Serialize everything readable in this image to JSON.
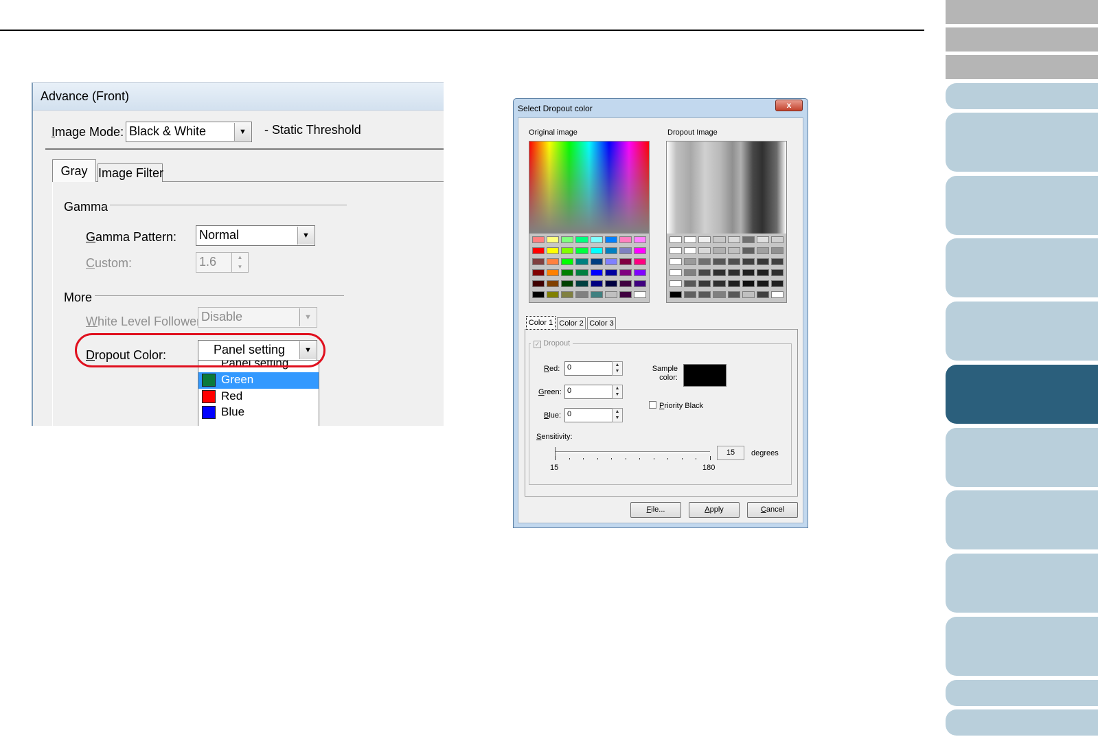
{
  "advance_dialog": {
    "title": "Advance (Front)",
    "image_mode_label": "Image Mode:",
    "image_mode_value": "Black & White",
    "static_threshold": "- Static Threshold",
    "tabs": [
      "Gray",
      "Image Filter"
    ],
    "gamma_group": "Gamma",
    "gamma_pattern_label": "Gamma Pattern:",
    "gamma_pattern_value": "Normal",
    "custom_label": "Custom:",
    "custom_value": "1.6",
    "more_group": "More",
    "white_level_label": "White Level Follower:",
    "white_level_value": "Disable",
    "dropout_label": "Dropout Color:",
    "dropout_value": "Panel setting",
    "dropdown_options": [
      {
        "label": "Panel setting",
        "color": ""
      },
      {
        "label": "Green",
        "color": "#0a7a3c",
        "selected": true
      },
      {
        "label": "Red",
        "color": "#ff0000"
      },
      {
        "label": "Blue",
        "color": "#0000ff"
      }
    ]
  },
  "select_dropout": {
    "title": "Select Dropout color",
    "close": "x",
    "original_label": "Original image",
    "dropout_image_label": "Dropout Image",
    "original_palette": [
      "#ff8080",
      "#ffff80",
      "#80ff80",
      "#00ff80",
      "#80ffff",
      "#0080ff",
      "#ff80c0",
      "#ff80ff",
      "#ff0000",
      "#ffff00",
      "#80ff00",
      "#00ff40",
      "#00ffff",
      "#0080c0",
      "#8080c0",
      "#ff00ff",
      "#804040",
      "#ff8040",
      "#00ff00",
      "#008080",
      "#004080",
      "#8080ff",
      "#800040",
      "#ff0080",
      "#800000",
      "#ff8000",
      "#008000",
      "#008040",
      "#0000ff",
      "#0000a0",
      "#800080",
      "#8000ff",
      "#400000",
      "#804000",
      "#004000",
      "#004040",
      "#000080",
      "#000040",
      "#400040",
      "#400080",
      "#000000",
      "#808000",
      "#808040",
      "#808080",
      "#408080",
      "#c0c0c0",
      "#400040",
      "#ffffff"
    ],
    "dropout_palette": [
      "#ffffff",
      "#ffffff",
      "#f0f0f0",
      "#c8c8c8",
      "#d8d8d8",
      "#707070",
      "#e0e0e0",
      "#d0d0d0",
      "#ffffff",
      "#ffffff",
      "#d8d8d8",
      "#b0b0b0",
      "#c0c0c0",
      "#606060",
      "#a0a0a0",
      "#909090",
      "#ffffff",
      "#9a9a9a",
      "#707070",
      "#585858",
      "#505050",
      "#404040",
      "#383838",
      "#404040",
      "#ffffff",
      "#808080",
      "#484848",
      "#303030",
      "#303030",
      "#202020",
      "#202020",
      "#303030",
      "#ffffff",
      "#585858",
      "#383838",
      "#303030",
      "#202020",
      "#101010",
      "#181818",
      "#202020",
      "#000000",
      "#606060",
      "#585858",
      "#808080",
      "#585858",
      "#c0c0c0",
      "#404040",
      "#ffffff"
    ],
    "tabs": [
      "Color 1",
      "Color 2",
      "Color 3"
    ],
    "dropout_check": "Dropout",
    "red_label": "Red:",
    "red_value": "0",
    "green_label": "Green:",
    "green_value": "0",
    "blue_label": "Blue:",
    "blue_value": "0",
    "sample_label": "Sample color:",
    "sample_color": "#000000",
    "priority_black": "Priority Black",
    "sensitivity_label": "Sensitivity:",
    "sensitivity_value": "15",
    "degrees": "degrees",
    "slider_min": "15",
    "slider_max": "180",
    "slider_position": 0,
    "buttons": {
      "file": "File...",
      "apply": "Apply",
      "cancel": "Cancel"
    }
  }
}
